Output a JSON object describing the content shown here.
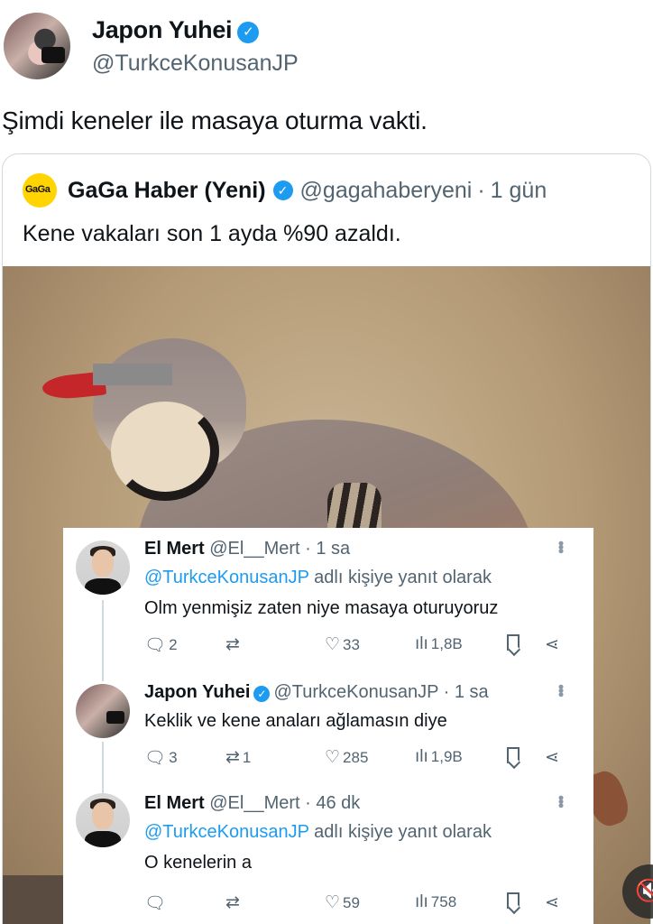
{
  "tweet": {
    "author_name": "Japon Yuhei",
    "author_handle": "@TurkceKonusanJP",
    "text": "Şimdi keneler ile masaya oturma vakti.",
    "verified_glyph": "✓"
  },
  "quoted": {
    "logo_text": "GaGa",
    "name": "GaGa Haber (Yeni)",
    "handle": "@gagahaberyeni",
    "separator": "·",
    "time": "1 gün",
    "text": "Kene vakaları son 1 ayda %90 azaldı.",
    "verified_glyph": "✓"
  },
  "replies": [
    {
      "name": "El Mert",
      "handle": "@El__Mert",
      "time": "· 1 sa",
      "reply_mention": "@TurkceKonusanJP",
      "reply_suffix": " adlı kişiye yanıt olarak",
      "text": "Olm yenmişiz zaten niye masaya oturuyoruz",
      "replies_count": "2",
      "retweets_count": "",
      "likes_count": "33",
      "views_count": "1,8B"
    },
    {
      "name": "Japon Yuhei",
      "handle": "@TurkceKonusanJP",
      "time": "· 1 sa",
      "text": "Keklik ve kene anaları ağlamasın diye",
      "replies_count": "3",
      "retweets_count": "1",
      "likes_count": "285",
      "views_count": "1,9B",
      "verified_glyph": "✓"
    },
    {
      "name": "El Mert",
      "handle": "@El__Mert",
      "time": "· 46 dk",
      "reply_mention": "@TurkceKonusanJP",
      "reply_suffix": " adlı kişiye yanıt olarak",
      "text": "O kenelerin a",
      "replies_count": "",
      "retweets_count": "",
      "likes_count": "59",
      "views_count": "758"
    }
  ],
  "icons": {
    "reply": "reply-icon",
    "retweet": "retweet-icon",
    "like": "heart-icon",
    "views": "views-icon",
    "bookmark": "bookmark-icon",
    "share": "share-icon",
    "more": "more-icon",
    "sound": "speaker-muted-icon"
  },
  "colors": {
    "accent": "#1d9bf0",
    "muted": "#536471",
    "text": "#0f1419",
    "gaga_yellow": "#ffd400",
    "beak_red": "#c4262a"
  }
}
